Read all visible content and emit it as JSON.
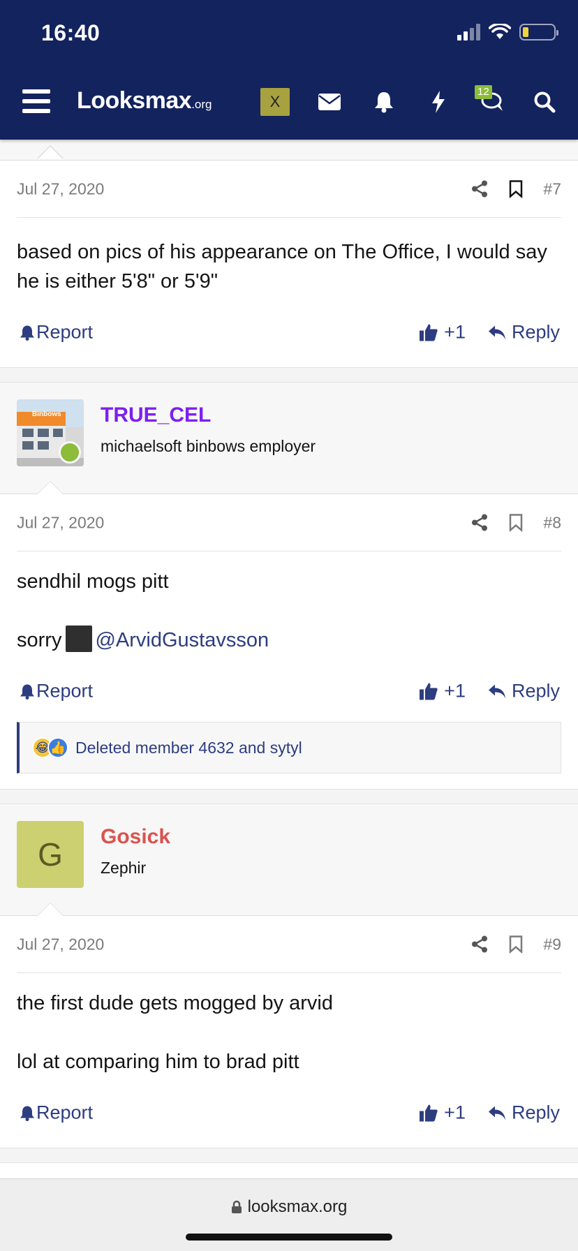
{
  "status_bar": {
    "time": "16:40"
  },
  "nav": {
    "logo_main": "Looksmax",
    "logo_suffix": ".org",
    "x_label": "X",
    "conversations_badge": "12"
  },
  "posts": [
    {
      "date": "Jul 27, 2020",
      "number": "#7",
      "paragraphs": [
        "based on pics of his appearance on The Office, I would say he is either 5'8\" or 5'9\""
      ],
      "report_label": "Report",
      "like_count": "+1",
      "reply_label": "Reply"
    },
    {
      "author": {
        "name": "TRUE_CEL",
        "title": "michaelsoft binbows employer",
        "name_color": "#7d1ff0",
        "online": true,
        "avatar_sign_text": "Binbows"
      },
      "date": "Jul 27, 2020",
      "number": "#8",
      "paragraphs": [
        "sendhil mogs pitt"
      ],
      "mention_prefix": "sorry",
      "mention": "@ArvidGustavsson",
      "report_label": "Report",
      "like_count": "+1",
      "reply_label": "Reply",
      "reactions_text": "Deleted member 4632 and sytyl",
      "reaction_icons": [
        "crying-laughing-icon",
        "thumbs-up-icon"
      ]
    },
    {
      "author": {
        "name": "Gosick",
        "title": "Zephir",
        "name_color": "#d9534f",
        "avatar_letter": "G"
      },
      "date": "Jul 27, 2020",
      "number": "#9",
      "paragraphs": [
        "the first dude gets mogged by arvid",
        "lol at comparing him to brad pitt"
      ],
      "report_label": "Report",
      "like_count": "+1",
      "reply_label": "Reply"
    }
  ],
  "browser": {
    "url": "looksmax.org"
  },
  "colors": {
    "header": "#13235e",
    "link": "#2d3d80",
    "online": "#8cbc3a",
    "x_button": "#a8a140"
  }
}
